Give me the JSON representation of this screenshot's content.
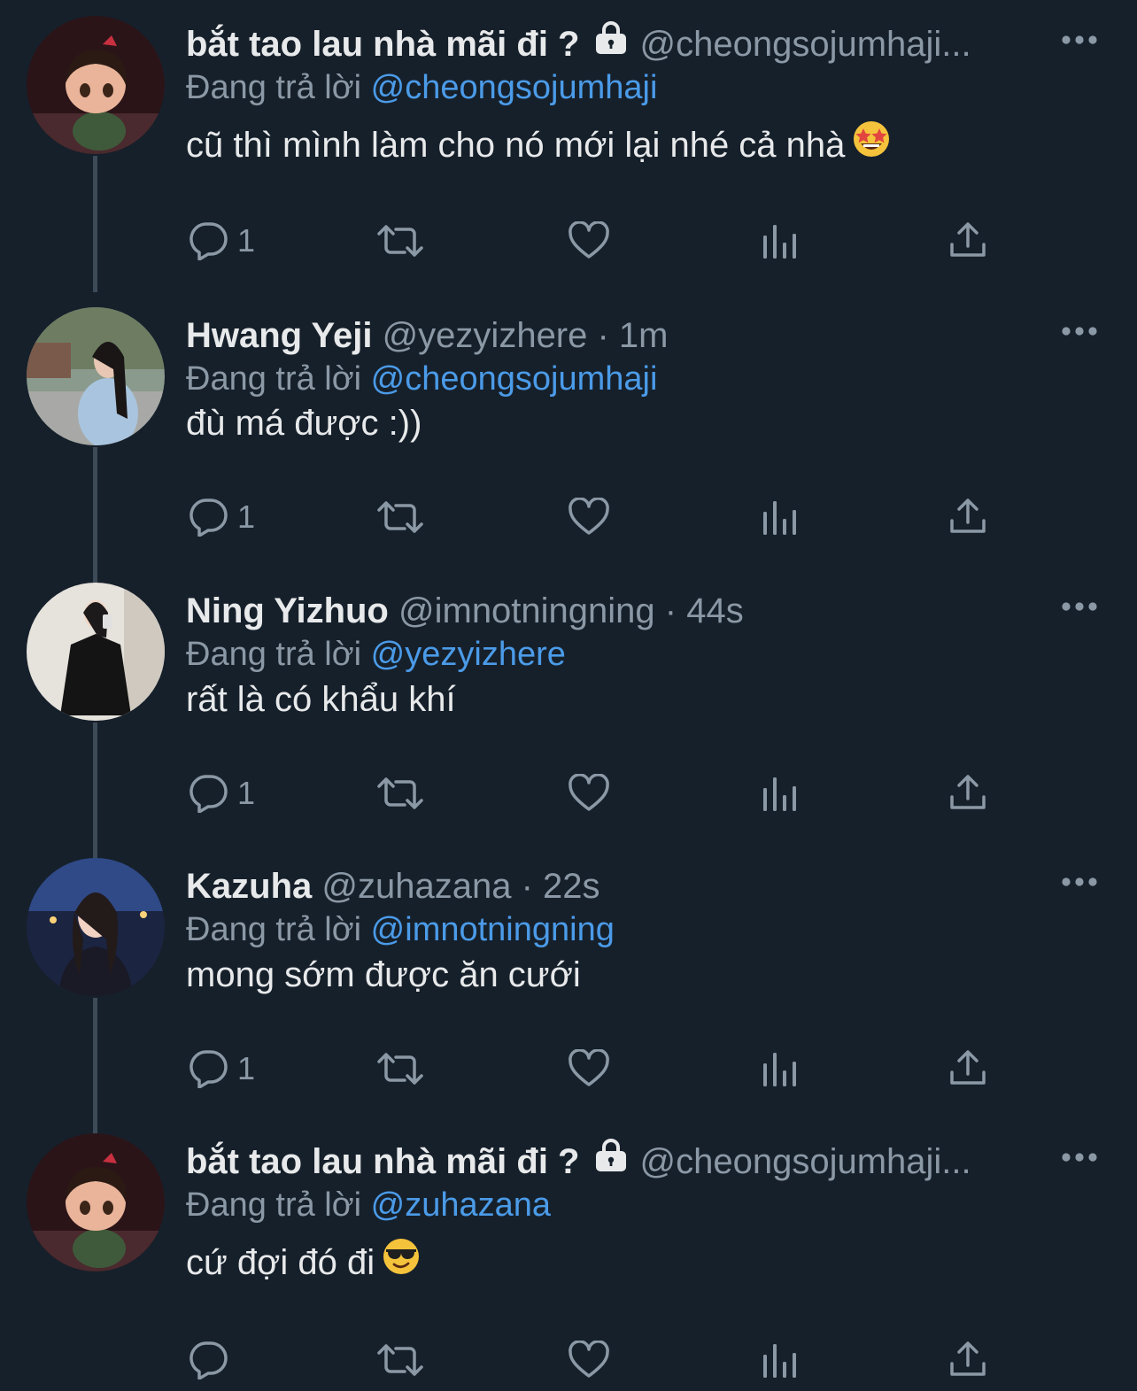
{
  "colors": {
    "background": "#16202b",
    "text": "#e7e9ea",
    "secondary": "#8b98a5",
    "mention": "#4b9be8",
    "thread_line": "#3d4a57"
  },
  "tweets": [
    {
      "name": "bắt tao lau nhà mãi đi ?",
      "protected": true,
      "handle_meta": "@cheongsojumhaji...",
      "reply_prefix": "Đang trả lời",
      "reply_to": "@cheongsojumhaji",
      "text": "cũ thì mình làm cho nó mới lại nhé cả nhà",
      "emoji": "star-struck",
      "reply_count": "1",
      "avatar": "cartoon-girl"
    },
    {
      "name": "Hwang Yeji",
      "protected": false,
      "handle_meta": "@yezyizhere · 1m",
      "reply_prefix": "Đang trả lời",
      "reply_to": "@cheongsojumhaji",
      "text": "đù má được :))",
      "emoji": "",
      "reply_count": "1",
      "avatar": "photo-street"
    },
    {
      "name": "Ning Yizhuo",
      "protected": false,
      "handle_meta": "@imnotningning · 44s",
      "reply_prefix": "Đang trả lời",
      "reply_to": "@yezyizhere",
      "text": "rất là có khẩu khí",
      "emoji": "",
      "reply_count": "1",
      "avatar": "photo-mirror"
    },
    {
      "name": "Kazuha",
      "protected": false,
      "handle_meta": "@zuhazana · 22s",
      "reply_prefix": "Đang trả lời",
      "reply_to": "@imnotningning",
      "text": "mong sớm được ăn cưới",
      "emoji": "",
      "reply_count": "1",
      "avatar": "photo-night"
    },
    {
      "name": "bắt tao lau nhà mãi đi ?",
      "protected": true,
      "handle_meta": "@cheongsojumhaji...",
      "reply_prefix": "Đang trả lời",
      "reply_to": "@zuhazana",
      "text": "cứ đợi đó đi",
      "emoji": "sunglasses-face",
      "reply_count": "",
      "avatar": "cartoon-girl"
    }
  ]
}
